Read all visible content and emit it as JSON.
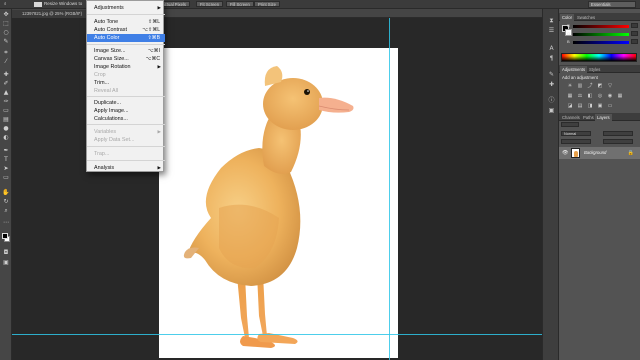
{
  "options_bar": {
    "resize_label": "Resize Windows to",
    "buttons": [
      "Actual Pixels",
      "Fit Screen",
      "Fill Screen",
      "Print Size"
    ],
    "workspace": "Essentials"
  },
  "document": {
    "tab_title": "12397821.jpg @ 25% (RGB/8*)"
  },
  "image_menu": {
    "items": [
      {
        "label": "Adjustments",
        "shortcut": "",
        "submenu": true,
        "disabled": false
      },
      {
        "label": "Auto Tone",
        "shortcut": "⇧⌘L",
        "submenu": false,
        "disabled": false
      },
      {
        "label": "Auto Contrast",
        "shortcut": "⌥⇧⌘L",
        "submenu": false,
        "disabled": false
      },
      {
        "label": "Auto Color",
        "shortcut": "⇧⌘B",
        "submenu": false,
        "disabled": false,
        "highlighted": true
      },
      {
        "label": "Image Size...",
        "shortcut": "⌥⌘I",
        "submenu": false,
        "disabled": false
      },
      {
        "label": "Canvas Size...",
        "shortcut": "⌥⌘C",
        "submenu": false,
        "disabled": false
      },
      {
        "label": "Image Rotation",
        "shortcut": "",
        "submenu": true,
        "disabled": false
      },
      {
        "label": "Crop",
        "shortcut": "",
        "submenu": false,
        "disabled": true
      },
      {
        "label": "Trim...",
        "shortcut": "",
        "submenu": false,
        "disabled": false
      },
      {
        "label": "Reveal All",
        "shortcut": "",
        "submenu": false,
        "disabled": true
      },
      {
        "label": "Duplicate...",
        "shortcut": "",
        "submenu": false,
        "disabled": false
      },
      {
        "label": "Apply Image...",
        "shortcut": "",
        "submenu": false,
        "disabled": false
      },
      {
        "label": "Calculations...",
        "shortcut": "",
        "submenu": false,
        "disabled": false
      },
      {
        "label": "Variables",
        "shortcut": "",
        "submenu": true,
        "disabled": true
      },
      {
        "label": "Apply Data Set...",
        "shortcut": "",
        "submenu": false,
        "disabled": true
      },
      {
        "label": "Trap...",
        "shortcut": "",
        "submenu": false,
        "disabled": true
      },
      {
        "label": "Analysis",
        "shortcut": "",
        "submenu": true,
        "disabled": false
      }
    ]
  },
  "panels": {
    "color_tabs": [
      "Color",
      "Swatches"
    ],
    "color_channels": [
      "R",
      "G",
      "B"
    ],
    "adjust_tabs": [
      "Adjustments",
      "Styles"
    ],
    "adjust_heading": "Add an adjustment",
    "layer_tabs": [
      "Channels",
      "Paths",
      "Layers"
    ],
    "blend_mode": "Normal",
    "layer_name": "Background"
  },
  "colors": {
    "accent": "#3f7fe6",
    "guide": "#2ec5e8",
    "canvas_bg": "#282828"
  },
  "icons": {
    "arrow": "submenu-arrow-icon",
    "eye": "eye-icon",
    "lock": "lock-icon"
  }
}
